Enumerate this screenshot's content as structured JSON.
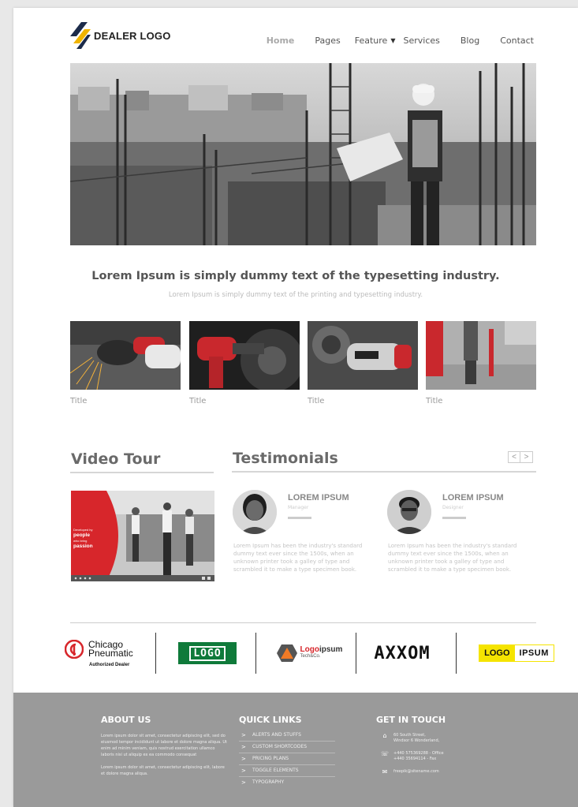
{
  "header": {
    "logo_text": "DEALER LOGO",
    "nav": [
      {
        "label": "Home",
        "active": true
      },
      {
        "label": "Pages"
      },
      {
        "label": "Feature"
      },
      {
        "label": "Services"
      },
      {
        "label": "Blog"
      },
      {
        "label": "Contact"
      }
    ]
  },
  "hero": {
    "headline": "Lorem Ipsum is simply dummy text of the typesetting industry.",
    "subline": "Lorem Ipsum is simply dummy text of the printing and typesetting industry."
  },
  "cards": [
    {
      "title": "Title"
    },
    {
      "title": "Title"
    },
    {
      "title": "Title"
    },
    {
      "title": "Title"
    }
  ],
  "video": {
    "heading": "Video Tour",
    "overlay_lines": [
      "Developed by",
      "people",
      "who bring",
      "passion"
    ]
  },
  "testimonials": {
    "heading": "Testimonials",
    "prev": "<",
    "next": ">",
    "items": [
      {
        "name": "LOREM IPSUM",
        "role": "Manager",
        "text": "Lorem Ipsum has been the industry's standard dummy text ever since the 1500s, when an unknown printer took a galley of type and scrambled it to make a type specimen book."
      },
      {
        "name": "LOREM IPSUM",
        "role": "Designer",
        "text": "Lorem Ipsum has been the industry's standard dummy text ever since the 1500s, when an unknown printer took a galley of type and scrambled it to make a type specimen book."
      }
    ]
  },
  "brands": {
    "chicago_1": "Chicago",
    "chicago_2": "Pneumatic",
    "chicago_sub": "Authorized Dealer",
    "logo": "LOGO",
    "logoipsum_a": "Logo",
    "logoipsum_b": "ipsum",
    "logoipsum_sub": "Tech&Co.",
    "axxom": "AXXOM",
    "logo_ipsum_1": "LOGO",
    "logo_ipsum_2": "IPSUM"
  },
  "footer": {
    "about": {
      "heading": "ABOUT US",
      "p1": "Lorem ipsum dolor sit amet, consectetur adipiscing elit, sed do eiusmod tempor incididunt ut labore et dolore magna aliqua. Ut enim ad minim veniam, quis nostrud exercitation ullamco laboris nisi ut aliquip ex ea commodo consequat",
      "p2": "Lorem ipsum dolor sit amet, consectetur adipiscing elit, labore et dolore magna aliqua."
    },
    "quick_links": {
      "heading": "QUICK LINKS",
      "items": [
        "ALERTS AND STUFFS",
        "CUSTOM SHORTCODES",
        "PRICING PLANS",
        "TOGGLE ELEMENTS",
        "TYPOGRAPHY"
      ]
    },
    "contact": {
      "heading": "GET IN TOUCH",
      "address_1": "60 South Street,",
      "address_2": "Windsor 6 Wonderland,",
      "phone_1": "+440 575369288 - Office",
      "phone_2": "+440 35694114 - Fax",
      "email": "freepik@sitename.com"
    }
  },
  "colors": {
    "accent_red": "#d7262b",
    "footer_bg": "#9a9a9a",
    "logo_green": "#0f7a3a",
    "logo_yellow": "#f5e400"
  }
}
